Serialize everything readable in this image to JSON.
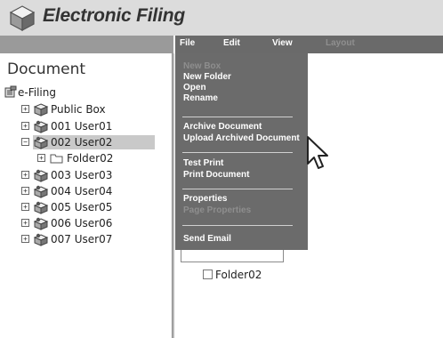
{
  "app": {
    "title": "Electronic Filing",
    "logo_icon": "cube-logo-icon"
  },
  "menubar": {
    "items": [
      {
        "label": "File",
        "enabled": true
      },
      {
        "label": "Edit",
        "enabled": true
      },
      {
        "label": "View",
        "enabled": true
      },
      {
        "label": "Layout",
        "enabled": false
      }
    ]
  },
  "file_menu": {
    "groups": [
      [
        {
          "label": "New Box",
          "enabled": false
        },
        {
          "label": "New Folder",
          "enabled": true
        },
        {
          "label": "Open",
          "enabled": true
        },
        {
          "label": "Rename",
          "enabled": true
        }
      ],
      [
        {
          "label": "Archive Document",
          "enabled": true
        },
        {
          "label": "Upload Archived Document",
          "enabled": true
        }
      ],
      [
        {
          "label": "Test Print",
          "enabled": true
        },
        {
          "label": "Print Document",
          "enabled": true
        }
      ],
      [
        {
          "label": "Properties",
          "enabled": true
        },
        {
          "label": "Page Properties",
          "enabled": false
        }
      ],
      [
        {
          "label": "Send Email",
          "enabled": true
        }
      ]
    ]
  },
  "left_panel": {
    "title": "Document",
    "tree": [
      {
        "label": "e-Filing",
        "icon": "efiling-root-icon",
        "expander": "",
        "level": 0
      },
      {
        "label": "Public Box",
        "icon": "public-box-icon",
        "expander": "+",
        "level": 1
      },
      {
        "label": "001 User01",
        "icon": "user-box-icon",
        "expander": "+",
        "level": 1
      },
      {
        "label": "002 User02",
        "icon": "user-box-icon",
        "expander": "−",
        "level": 1,
        "selected": true
      },
      {
        "label": "Folder02",
        "icon": "folder-icon",
        "expander": "+",
        "level": 2
      },
      {
        "label": "003 User03",
        "icon": "user-box-icon",
        "expander": "+",
        "level": 1
      },
      {
        "label": "004 User04",
        "icon": "user-box-icon",
        "expander": "+",
        "level": 1
      },
      {
        "label": "005 User05",
        "icon": "user-box-icon",
        "expander": "+",
        "level": 1
      },
      {
        "label": "006 User06",
        "icon": "user-box-icon",
        "expander": "+",
        "level": 1
      },
      {
        "label": "007 User07",
        "icon": "user-box-icon",
        "expander": "+",
        "level": 1
      }
    ]
  },
  "content": {
    "folder_item": {
      "label": "Folder02",
      "checked": false
    }
  },
  "colors": {
    "header_bg": "#dcdcdc",
    "menubar_bg": "#6a6a6a",
    "menu_bg": "#6b6b6b",
    "selection_bg": "#c9c9c9"
  }
}
